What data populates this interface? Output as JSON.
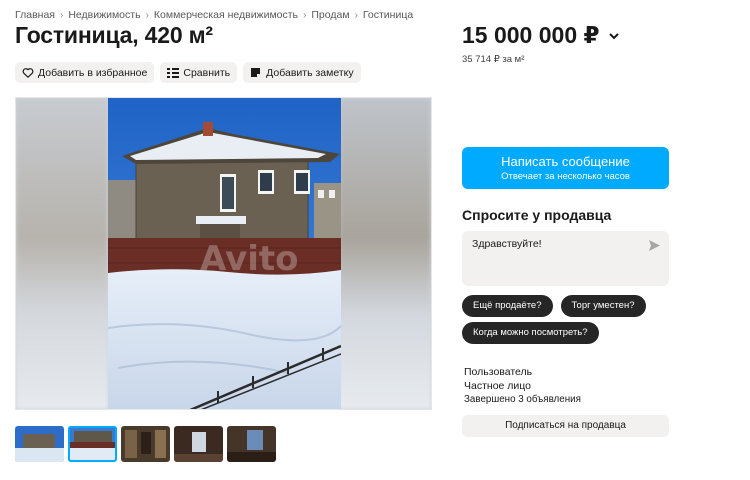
{
  "breadcrumb": [
    {
      "label": "Главная"
    },
    {
      "label": "Недвижимость"
    },
    {
      "label": "Коммерческая недвижимость"
    },
    {
      "label": "Продам"
    },
    {
      "label": "Гостиница"
    }
  ],
  "listing": {
    "title": "Гостиница, 420 м²",
    "price": "15 000 000 ₽",
    "price_per_meter": "35 714 ₽ за м²"
  },
  "actions": {
    "favorite": "Добавить в избранное",
    "compare": "Сравнить",
    "note": "Добавить заметку"
  },
  "gallery": {
    "watermark": "Avito",
    "thumbnail_count": 5,
    "active_index": 1
  },
  "contact": {
    "message_button": "Написать сообщение",
    "message_sub": "Отвечает за несколько часов"
  },
  "ask": {
    "title": "Спросите у продавца",
    "input_value": "Здравствуйте!",
    "chips": [
      "Ещё продаёте?",
      "Торг уместен?",
      "Когда можно посмотреть?"
    ]
  },
  "seller": {
    "name": "Пользователь",
    "type": "Частное лицо",
    "completed": "Завершено 3 объявления",
    "subscribe": "Подписаться на продавца"
  },
  "colors": {
    "accent": "#00aaff",
    "chip": "#262626",
    "button_bg": "#f2f1f0"
  }
}
